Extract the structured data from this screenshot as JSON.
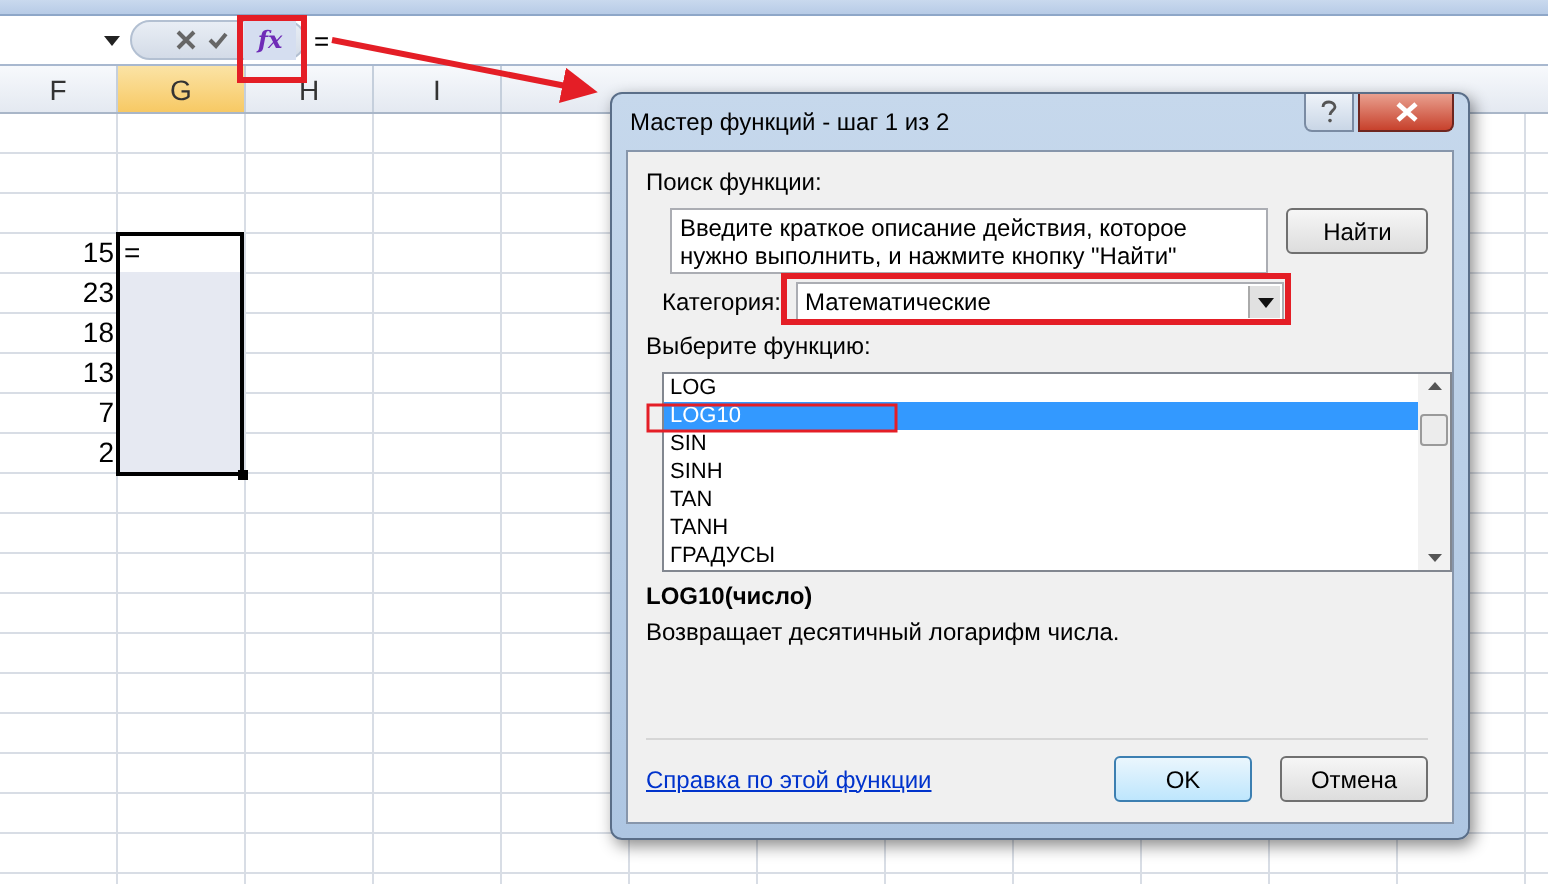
{
  "formula_bar": {
    "function_button": "fx",
    "formula": "="
  },
  "sheet": {
    "columns": [
      "F",
      "G",
      "H",
      "I"
    ],
    "rows": [
      {
        "value": "15",
        "entry": "=",
        "active": true
      },
      {
        "value": "23",
        "active": false
      },
      {
        "value": "18",
        "active": false
      },
      {
        "value": "13",
        "active": false
      },
      {
        "value": "7",
        "active": false
      },
      {
        "value": "2",
        "active": false
      }
    ]
  },
  "dialog": {
    "title": "Мастер функций - шаг 1 из 2",
    "search_label": "Поиск функции:",
    "search_field": {
      "value": "Введите краткое описание действия, которое нужно выполнить, и нажмите кнопку \"Найти\""
    },
    "find_button": "Найти",
    "category_label": "Категория:",
    "category": "Математические",
    "list_label": "Выберите функцию:",
    "functions": [
      {
        "name": "LOG",
        "selected": false
      },
      {
        "name": "LOG10",
        "selected": true
      },
      {
        "name": "SIN",
        "selected": false
      },
      {
        "name": "SINH",
        "selected": false
      },
      {
        "name": "TAN",
        "selected": false
      },
      {
        "name": "TANH",
        "selected": false
      },
      {
        "name": "ГРАДУСЫ",
        "selected": false
      }
    ],
    "signature": "LOG10(число)",
    "description": "Возвращает десятичный логарифм числа.",
    "help_link": "Справка по этой функции",
    "buttons": [
      "OK",
      "Отмена"
    ]
  }
}
